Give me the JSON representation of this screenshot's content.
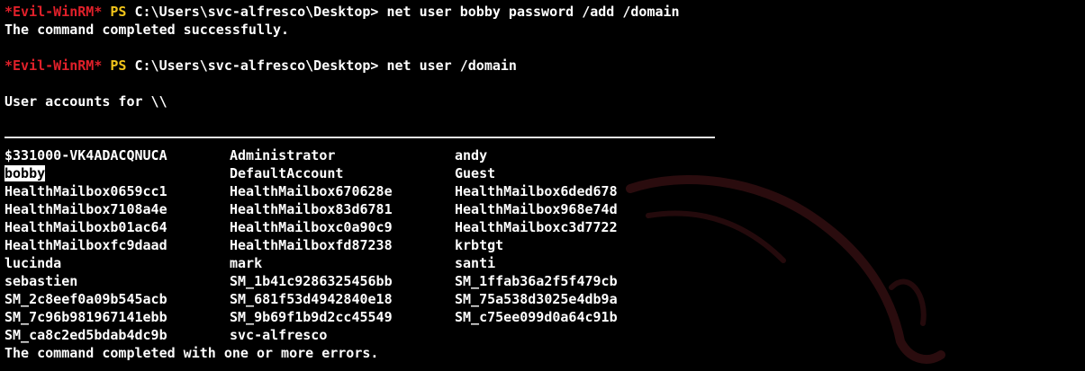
{
  "terminal": {
    "prompt_tag": "*Evil-WinRM*",
    "prompt_ps": "PS",
    "commands": [
      {
        "path": "C:\\Users\\svc-alfresco\\Desktop>",
        "cmd": "net user bobby password /add /domain"
      },
      {
        "path": "C:\\Users\\svc-alfresco\\Desktop>",
        "cmd": "net user /domain"
      }
    ],
    "output_success": "The command completed successfully.",
    "accounts_header": "User accounts for \\\\",
    "accounts": [
      [
        "$331000-VK4ADACQNUCA",
        "Administrator",
        "andy"
      ],
      [
        "bobby",
        "DefaultAccount",
        "Guest"
      ],
      [
        "HealthMailbox0659cc1",
        "HealthMailbox670628e",
        "HealthMailbox6ded678"
      ],
      [
        "HealthMailbox7108a4e",
        "HealthMailbox83d6781",
        "HealthMailbox968e74d"
      ],
      [
        "HealthMailboxb01ac64",
        "HealthMailboxc0a90c9",
        "HealthMailboxc3d7722"
      ],
      [
        "HealthMailboxfc9daad",
        "HealthMailboxfd87238",
        "krbtgt"
      ],
      [
        "lucinda",
        "mark",
        "santi"
      ],
      [
        "sebastien",
        "SM_1b41c9286325456bb",
        "SM_1ffab36a2f5f479cb"
      ],
      [
        "SM_2c8eef0a09b545acb",
        "SM_681f53d4942840e18",
        "SM_75a538d3025e4db9a"
      ],
      [
        "SM_7c96b981967141ebb",
        "SM_9b69f1b9d2cc45549",
        "SM_c75ee099d0a64c91b"
      ],
      [
        "SM_ca8c2ed5bdab4dc9b",
        "svc-alfresco",
        ""
      ]
    ],
    "highlighted_account": "bobby",
    "output_errors": "The command completed with one or more errors.",
    "colors": {
      "background": "#000000",
      "text": "#ffffff",
      "prompt_tag": "#e0202a",
      "prompt_ps": "#f2c51a",
      "watermark": "#2a0c0e"
    }
  }
}
